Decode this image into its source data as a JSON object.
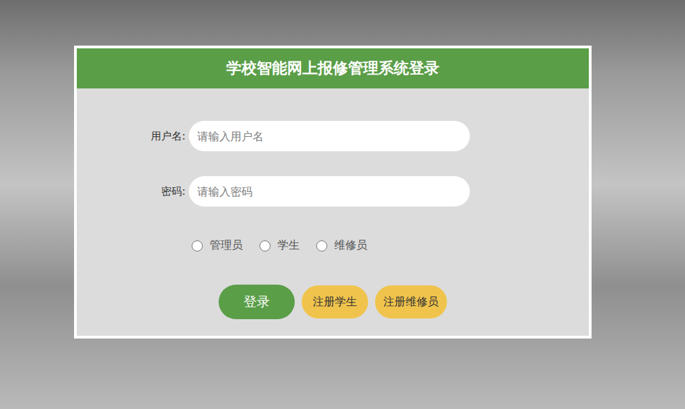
{
  "window": {
    "title": "学校智能网上报修管理系统登录"
  },
  "fields": [
    {
      "label": "用户名:",
      "placeholder": "请输入用户名",
      "type": "text"
    },
    {
      "label": "密码:",
      "placeholder": "请输入密码",
      "type": "password"
    }
  ],
  "roles": [
    {
      "label": "管理员",
      "selected": false
    },
    {
      "label": "学生",
      "selected": false
    },
    {
      "label": "维修员",
      "selected": false
    }
  ],
  "buttons": [
    {
      "label": "登录",
      "kind": "primary"
    },
    {
      "label": "注册学生",
      "kind": "secondary"
    },
    {
      "label": "注册维修员",
      "kind": "secondary"
    }
  ]
}
